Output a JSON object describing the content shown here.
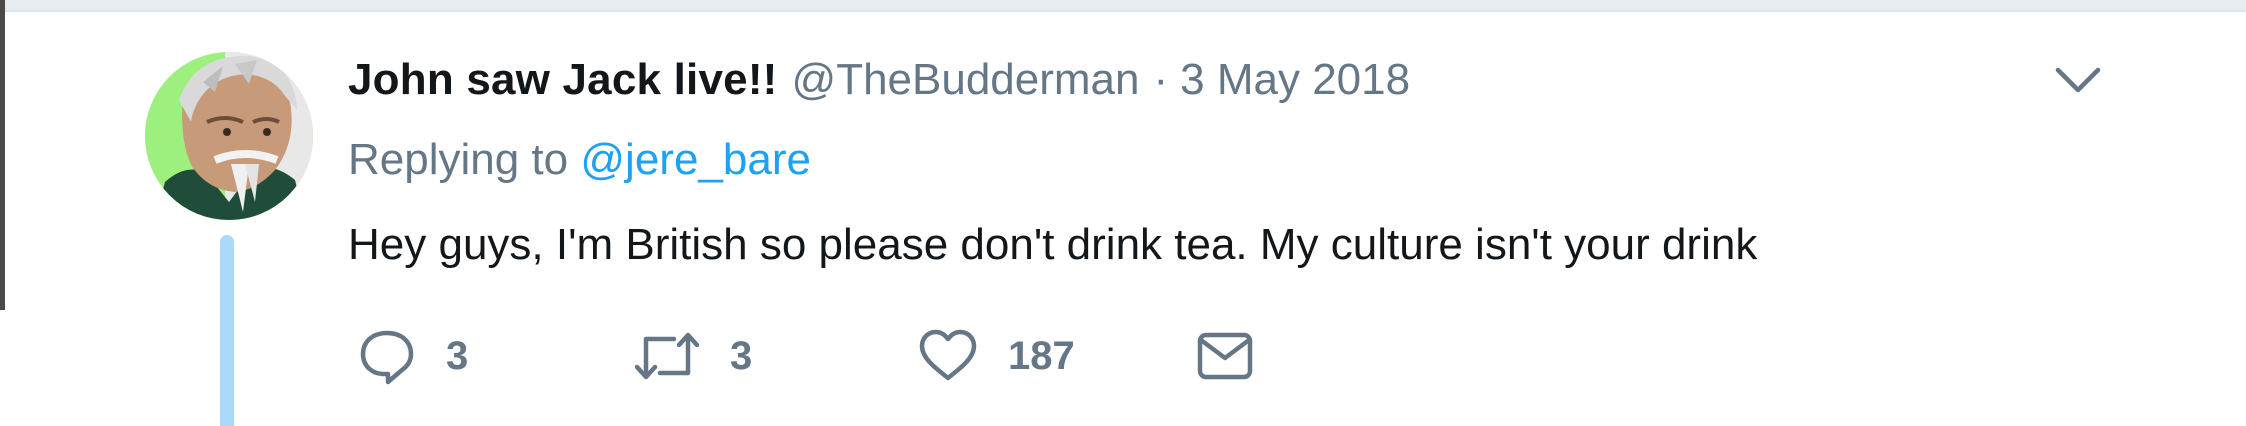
{
  "tweet": {
    "display_name": "John saw Jack live!!",
    "handle": "@TheBudderman",
    "separator": "·",
    "date": "3 May 2018",
    "replying_prefix": "Replying to",
    "replying_to": "@jere_bare",
    "text": "Hey guys, I'm British so please don't drink tea. My culture isn't your drink"
  },
  "actions": {
    "replies": "3",
    "retweets": "3",
    "likes": "187"
  },
  "icons": {
    "more": "chevron-down-icon",
    "reply": "reply-icon",
    "retweet": "retweet-icon",
    "like": "heart-icon",
    "message": "envelope-icon"
  },
  "colors": {
    "link": "#1da1f2",
    "muted": "#657786",
    "text": "#14171a",
    "thread_line": "#a9d9fb",
    "avatar_background": "#9df07e"
  }
}
